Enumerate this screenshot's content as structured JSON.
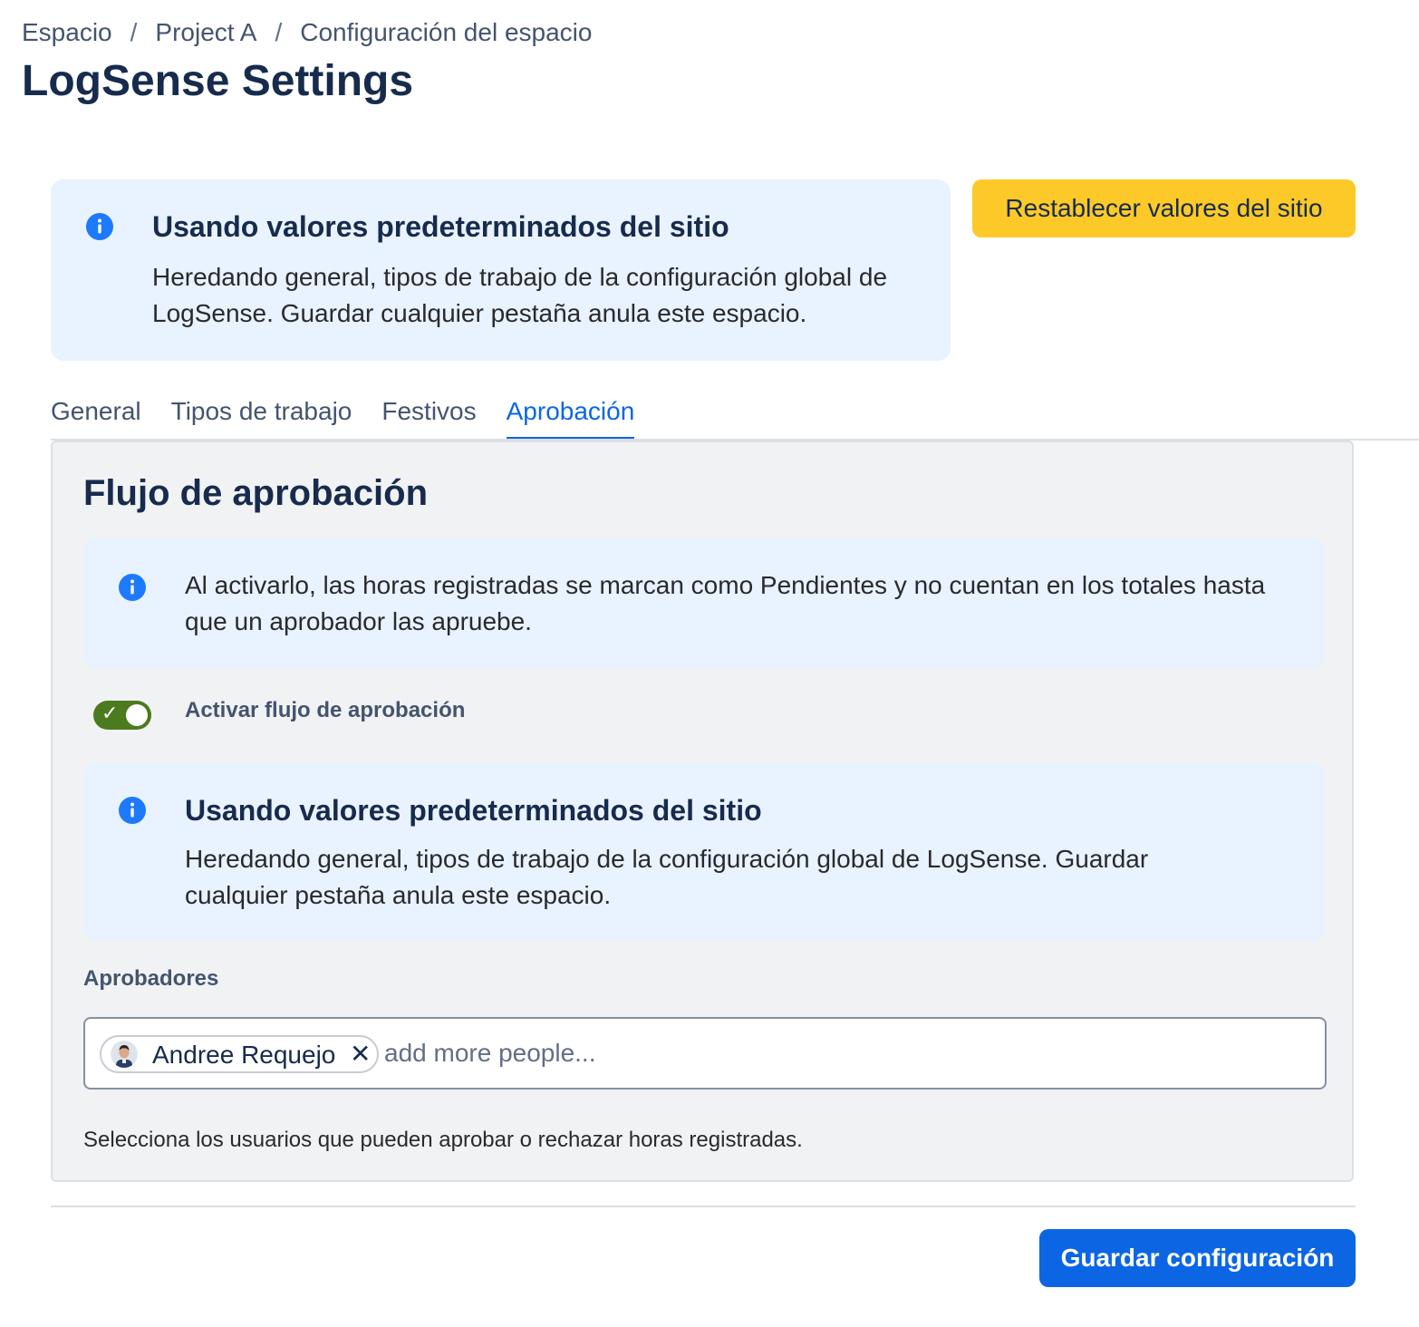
{
  "breadcrumb": [
    "Espacio",
    "Project A",
    "Configuración del espacio"
  ],
  "breadcrumb_separator": "/",
  "page": {
    "title": "LogSense Settings"
  },
  "top_notice": {
    "icon": "info-icon",
    "title": "Usando valores predeterminados del sitio",
    "text": "Heredando general, tipos de trabajo de la configuración global de LogSense. Guardar cualquier pestaña anula este espacio."
  },
  "reset_button": {
    "label": "Restablecer valores del sitio",
    "color": "#fcc928"
  },
  "tabs": [
    {
      "label": "General",
      "active": false
    },
    {
      "label": "Tipos de trabajo",
      "active": false
    },
    {
      "label": "Festivos",
      "active": false
    },
    {
      "label": "Aprobación",
      "active": true
    }
  ],
  "panel": {
    "title": "Flujo de aprobación",
    "approval_notice": {
      "icon": "info-icon",
      "text": "Al activarlo, las horas registradas se marcan como Pendientes y no cuentan en los totales hasta que un aprobador las apruebe."
    },
    "toggle": {
      "label": "Activar flujo de aprobación",
      "checked": true,
      "color": "#4c7a1e"
    },
    "site_notice": {
      "icon": "info-icon",
      "title": "Usando valores predeterminados del sitio",
      "text": "Heredando general, tipos de trabajo de la configuración global de LogSense. Guardar cualquier pestaña anula este espacio."
    },
    "approvers": {
      "label": "Aprobadores",
      "selected": [
        {
          "name": "Andree Requejo",
          "avatar": "avatar"
        }
      ],
      "placeholder": "add more people...",
      "helper": "Selecciona los usuarios que pueden aprobar o rechazar horas registradas."
    }
  },
  "save_button": {
    "label": "Guardar configuración",
    "color": "#0c66e4"
  },
  "colors": {
    "accent": "#0c66e4",
    "info_background": "#e9f2ff",
    "info_icon": "#1d7afc"
  }
}
